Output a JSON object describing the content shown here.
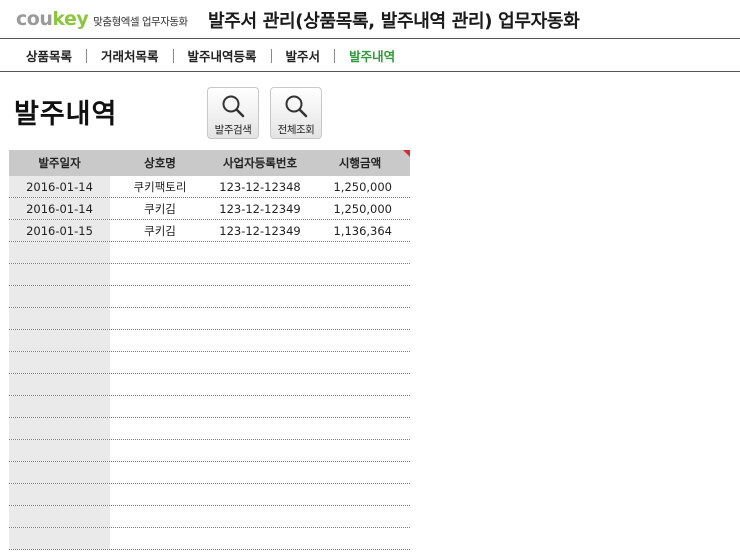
{
  "header": {
    "logo_prefix": "cou",
    "logo_accent": "key",
    "logo_tagline": "맞춤형엑셀 업무자동화",
    "title": "발주서 관리(상품목록, 발주내역 관리) 업무자동화"
  },
  "nav": {
    "items": [
      {
        "label": "상품목록"
      },
      {
        "label": "거래처목록"
      },
      {
        "label": "발주내역등록"
      },
      {
        "label": "발주서"
      },
      {
        "label": "발주내역"
      }
    ],
    "active": "발주내역"
  },
  "page": {
    "title": "발주내역"
  },
  "buttons": {
    "search_label": "발주검색",
    "view_all_label": "전체조회",
    "icon": "magnifier-icon"
  },
  "table": {
    "headers": [
      "발주일자",
      "상호명",
      "사업자등록번호",
      "시행금액"
    ],
    "rows": [
      [
        "2016-01-14",
        "쿠키팩토리",
        "123-12-12348",
        "1,250,000"
      ],
      [
        "2016-01-14",
        "쿠키김",
        "123-12-12349",
        "1,250,000"
      ],
      [
        "2016-01-15",
        "쿠키김",
        "123-12-12349",
        "1,136,364"
      ]
    ],
    "empty_rows": 14
  },
  "colors": {
    "logo_gray": "#9a9a9a",
    "logo_green": "#8cc63f",
    "active_nav": "#2f9a3a",
    "header_bg": "#c9c9c9",
    "date_column_bg": "#eaeaea",
    "note_marker": "#d03030"
  }
}
